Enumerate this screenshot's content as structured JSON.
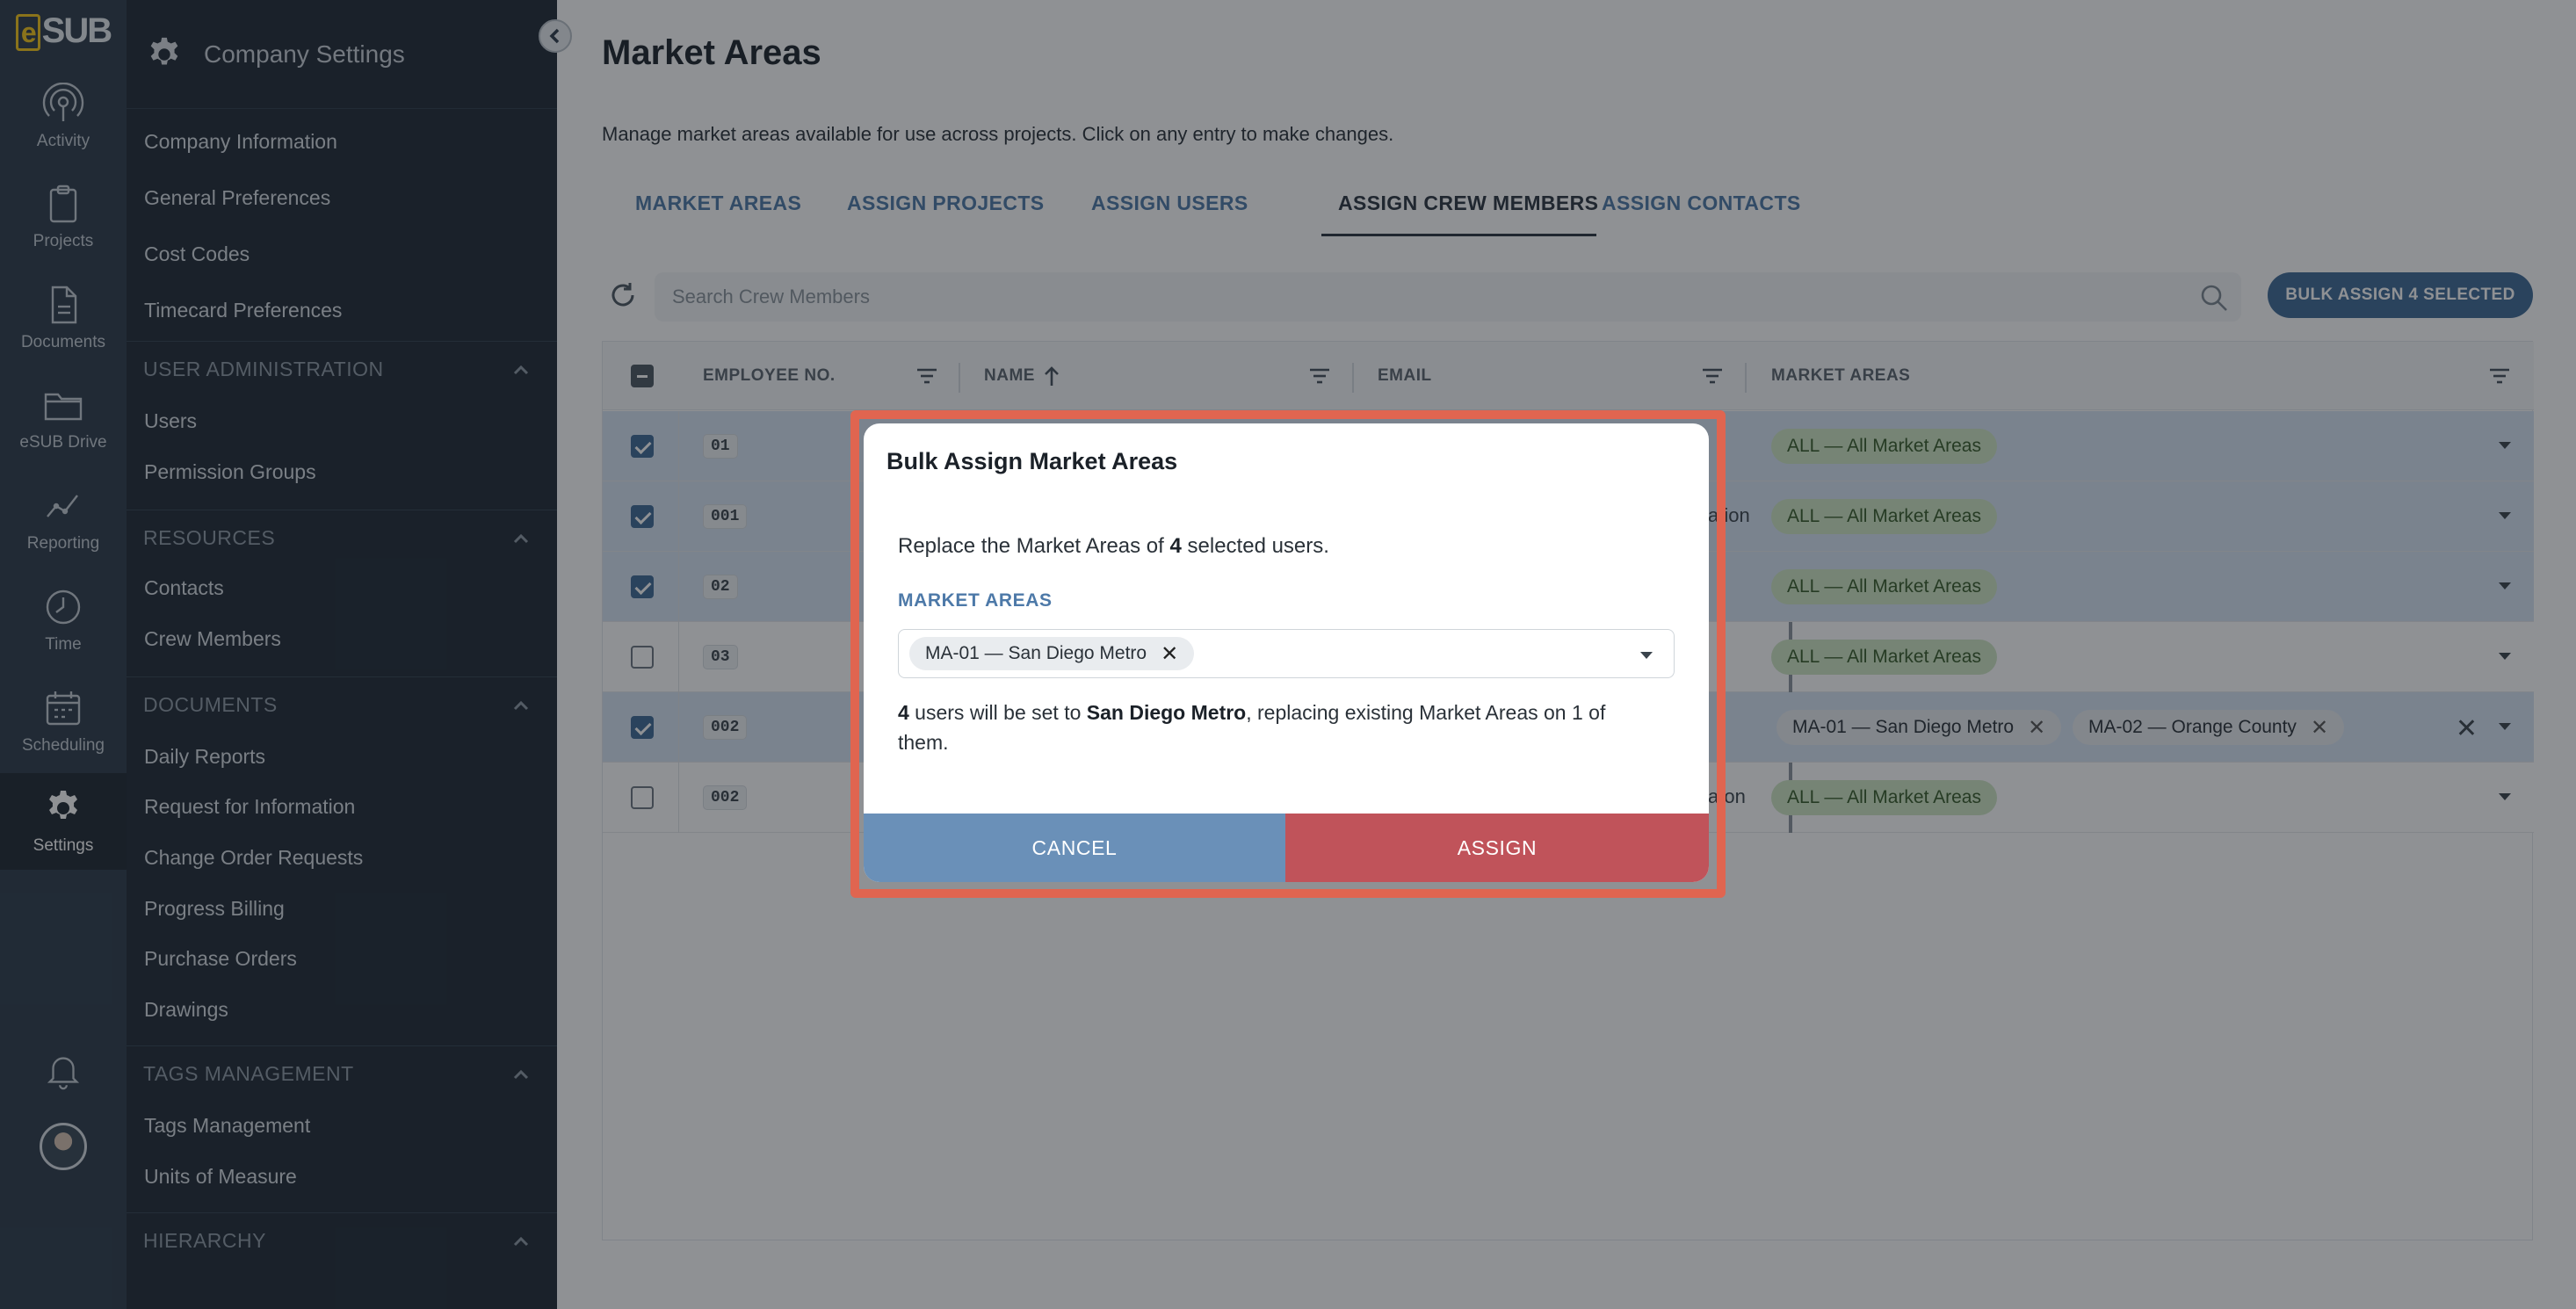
{
  "app": {
    "logo_text": "SUB",
    "logo_mark": "e"
  },
  "rail": {
    "items": [
      {
        "label": "Activity",
        "icon": "activity-icon"
      },
      {
        "label": "Projects",
        "icon": "clipboard-icon"
      },
      {
        "label": "Documents",
        "icon": "document-icon"
      },
      {
        "label": "eSUB Drive",
        "icon": "folder-icon"
      },
      {
        "label": "Reporting",
        "icon": "chart-icon"
      },
      {
        "label": "Time",
        "icon": "clock-icon"
      },
      {
        "label": "Scheduling",
        "icon": "calendar-icon"
      },
      {
        "label": "Settings",
        "icon": "gear-icon"
      }
    ],
    "bottom": [
      "bell-icon",
      "avatar"
    ]
  },
  "panel": {
    "title": "Company Settings",
    "top_items": [
      "Company Information",
      "General Preferences",
      "Cost Codes",
      "Timecard Preferences"
    ],
    "sections": [
      {
        "title": "USER ADMINISTRATION",
        "items": [
          "Users",
          "Permission Groups"
        ]
      },
      {
        "title": "RESOURCES",
        "items": [
          "Contacts",
          "Crew Members"
        ]
      },
      {
        "title": "DOCUMENTS",
        "items": [
          "Daily Reports",
          "Request for Information",
          "Change Order Requests",
          "Progress Billing",
          "Purchase Orders",
          "Drawings"
        ]
      },
      {
        "title": "TAGS MANAGEMENT",
        "items": [
          "Tags Management",
          "Units of Measure"
        ]
      },
      {
        "title": "HIERARCHY",
        "items": []
      }
    ]
  },
  "main": {
    "title": "Market Areas",
    "description": "Manage market areas available for use across projects. Click on any entry to make changes.",
    "tabs": [
      {
        "label": "MARKET AREAS"
      },
      {
        "label": "ASSIGN PROJECTS"
      },
      {
        "label": "ASSIGN USERS"
      },
      {
        "label": "ASSIGN CREW MEMBERS",
        "active": true
      },
      {
        "label": "ASSIGN CONTACTS"
      }
    ],
    "search": {
      "placeholder": "Search Crew Members",
      "value": ""
    },
    "bulk_button": "BULK ASSIGN 4 SELECTED",
    "table": {
      "columns": [
        "EMPLOYEE NO.",
        "NAME",
        "EMAIL",
        "MARKET AREAS"
      ],
      "rows": [
        {
          "checked": true,
          "emp_no": "01",
          "email_fragment": "",
          "market_areas": [
            "ALL — All Market Areas"
          ]
        },
        {
          "checked": true,
          "emp_no": "001",
          "email_fragment": "ation",
          "market_areas": [
            "ALL — All Market Areas"
          ]
        },
        {
          "checked": true,
          "emp_no": "02",
          "email_fragment": "",
          "market_areas": [
            "ALL — All Market Areas"
          ]
        },
        {
          "checked": false,
          "emp_no": "03",
          "email_fragment": "",
          "market_areas": [
            "ALL — All Market Areas"
          ]
        },
        {
          "checked": true,
          "emp_no": "002",
          "email_fragment": "",
          "market_areas": [
            "MA-01 — San Diego Metro",
            "MA-02 — Orange County"
          ]
        },
        {
          "checked": false,
          "emp_no": "002",
          "email_fragment": "a on",
          "market_areas": [
            "ALL — All Market Areas"
          ]
        }
      ]
    }
  },
  "modal": {
    "title": "Bulk Assign Market Areas",
    "text_pre": "Replace the Market Areas of ",
    "count": "4",
    "text_post": " selected users.",
    "label": "MARKET AREAS",
    "selected_chip": "MA-01 — San Diego Metro",
    "note_count": "4",
    "note_mid": " users will be set to ",
    "note_target": "San Diego Metro",
    "note_end": ", replacing existing Market Areas on 1 of them.",
    "cancel_label": "CANCEL",
    "assign_label": "ASSIGN"
  },
  "colors": {
    "rail_bg": "#2c3a4a",
    "panel_bg": "#1f2a35",
    "accent": "#3f6a96",
    "tab_blue": "#4d79a8",
    "chip_green": "#cfe7c4",
    "assign_red": "#c0535a",
    "cancel_blue": "#6a90b8",
    "modal_outline": "#e06550"
  }
}
